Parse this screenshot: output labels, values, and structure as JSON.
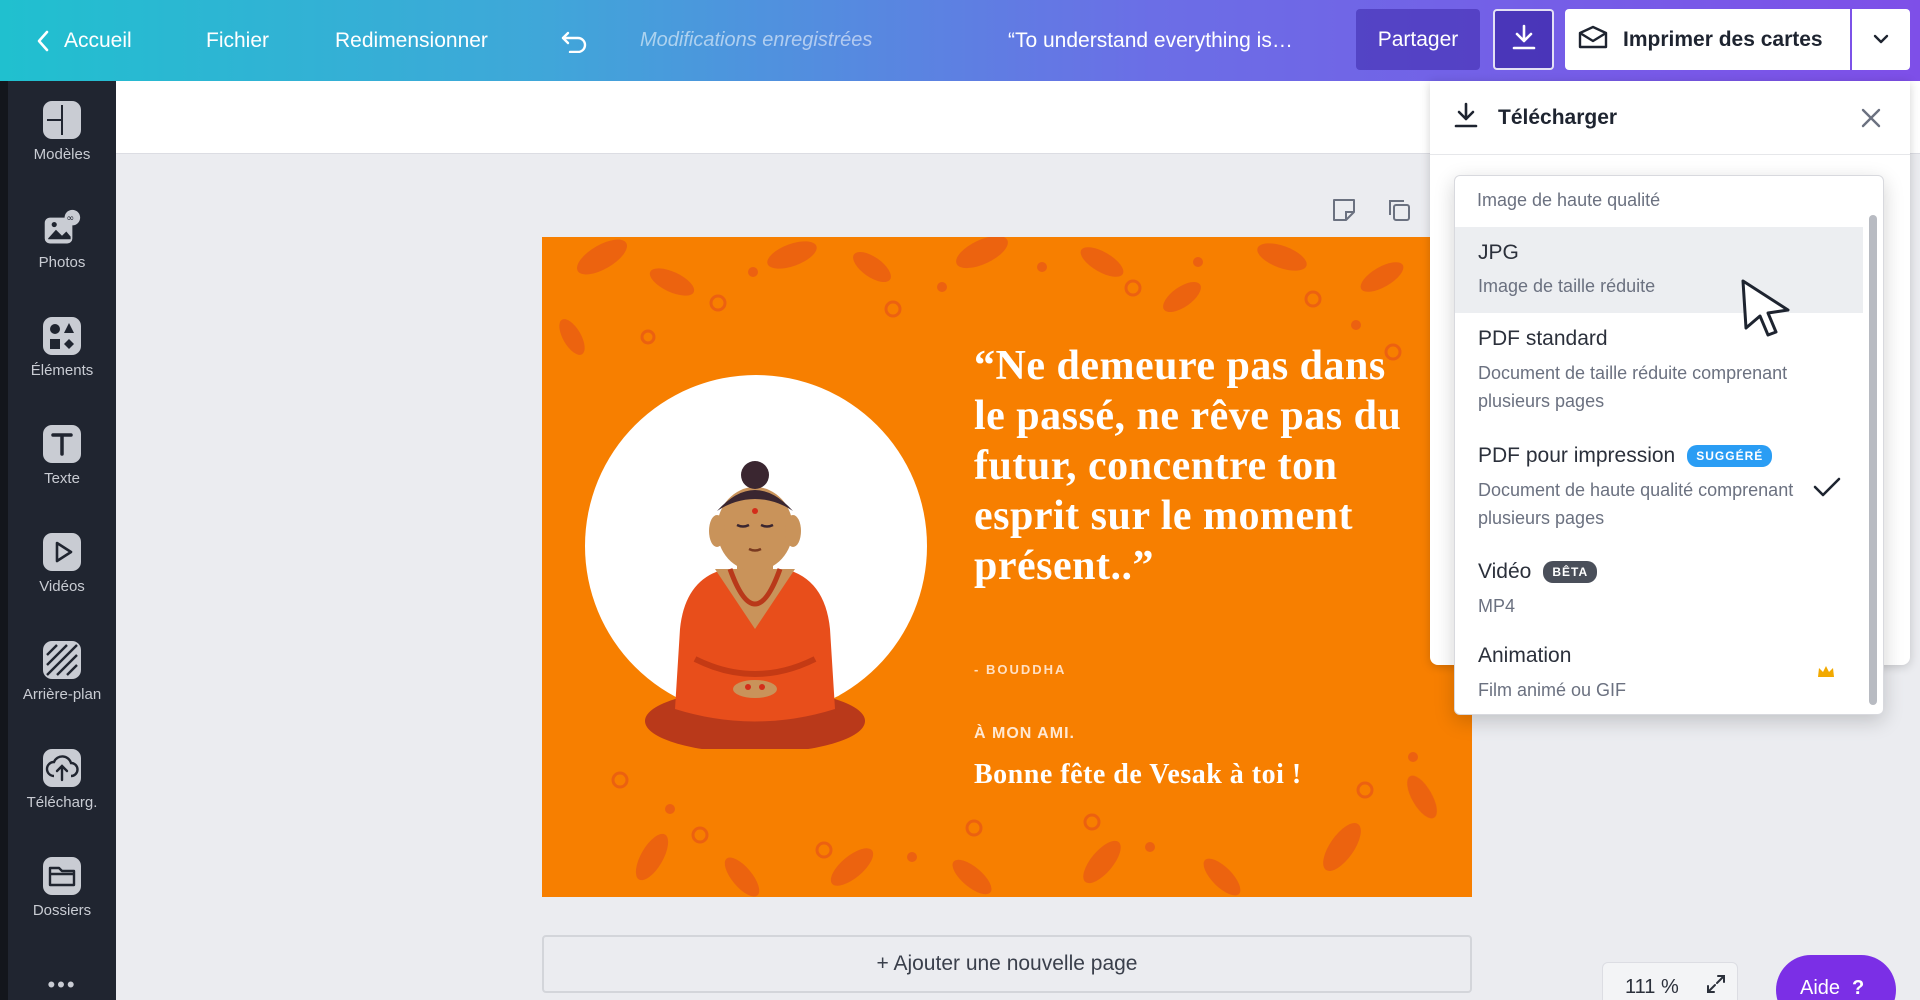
{
  "topbar": {
    "back_label": "Accueil",
    "file_label": "Fichier",
    "resize_label": "Redimensionner",
    "save_status": "Modifications enregistrées",
    "doc_title": "“To understand everything is…",
    "share_label": "Partager",
    "print_label": "Imprimer des cartes"
  },
  "sidebar": {
    "items": [
      {
        "label": "Modèles",
        "icon": "templates-icon"
      },
      {
        "label": "Photos",
        "icon": "photos-icon"
      },
      {
        "label": "Éléments",
        "icon": "elements-icon"
      },
      {
        "label": "Texte",
        "icon": "text-icon"
      },
      {
        "label": "Vidéos",
        "icon": "videos-icon"
      },
      {
        "label": "Arrière-plan",
        "icon": "background-icon"
      },
      {
        "label": "Télécharg.",
        "icon": "upload-icon"
      },
      {
        "label": "Dossiers",
        "icon": "folders-icon"
      }
    ],
    "more": "•••"
  },
  "card": {
    "quote": "“Ne demeure pas dans le passé, ne rêve pas du futur, concentre ton esprit sur le moment présent..”",
    "author": "- BOUDDHA",
    "dedication": "À MON AMI.",
    "greeting": "Bonne fête de Vesak à toi !",
    "background_color": "#f77f00"
  },
  "add_page_label": "+ Ajouter une nouvelle page",
  "zoom": {
    "level": "111 %"
  },
  "help_label": "Aide",
  "help_icon": "?",
  "download_panel": {
    "title": "Télécharger",
    "format_list": {
      "header_desc": "Image de haute qualité",
      "options": [
        {
          "name": "JPG",
          "desc": "Image de taille réduite",
          "hovered": true
        },
        {
          "name": "PDF standard",
          "desc": "Document de taille réduite comprenant plusieurs pages"
        },
        {
          "name": "PDF pour impression",
          "badge": "SUGGÉRÉ",
          "desc": "Document de haute qualité comprenant plusieurs pages",
          "selected": true
        },
        {
          "name": "Vidéo",
          "badge": "BÊTA",
          "desc": "MP4"
        },
        {
          "name": "Animation",
          "desc": "Film animé ou GIF",
          "premium": true
        }
      ]
    }
  },
  "colors": {
    "topbar_start": "#20c0cf",
    "topbar_end": "#7e4fe8",
    "sidebar": "#202530",
    "accent_badge": "#2a9df4",
    "help": "#7b2fe6",
    "crown": "#f2a900"
  }
}
